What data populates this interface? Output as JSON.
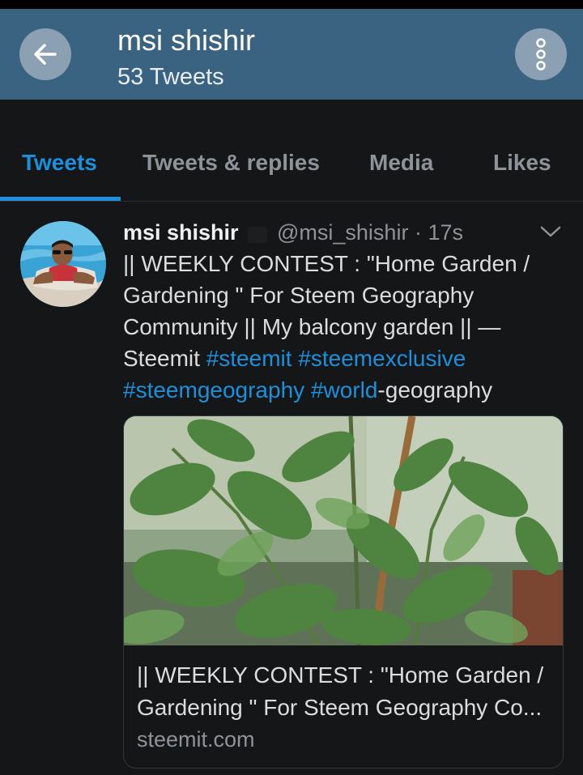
{
  "header": {
    "title": "msi shishir",
    "subtitle": "53 Tweets",
    "back_icon": "arrow-left-icon",
    "more_icon": "more-vertical-icon"
  },
  "tabs": [
    {
      "label": "Tweets",
      "active": true
    },
    {
      "label": "Tweets & replies",
      "active": false
    },
    {
      "label": "Media",
      "active": false
    },
    {
      "label": "Likes",
      "active": false
    }
  ],
  "tweet": {
    "name": "msi shishir",
    "handle": "@msi_shishir",
    "time": "17s",
    "text_plain": "|| WEEKLY CONTEST : \"Home Garden / Gardening \" For Steem Geography Community || My balcony garden || — Steemit ",
    "hashtags": [
      "#steemit",
      "#steemexclusive",
      "#steemgeography",
      "#world"
    ],
    "text_tail": "-geography",
    "card": {
      "title": "|| WEEKLY CONTEST : \"Home Garden / Gardening \" For Steem Geography Co...",
      "domain": "steemit.com"
    }
  },
  "colors": {
    "header_bg": "#3a6382",
    "accent": "#1e8fdb",
    "background": "#151618",
    "muted_text": "#8e9399"
  }
}
